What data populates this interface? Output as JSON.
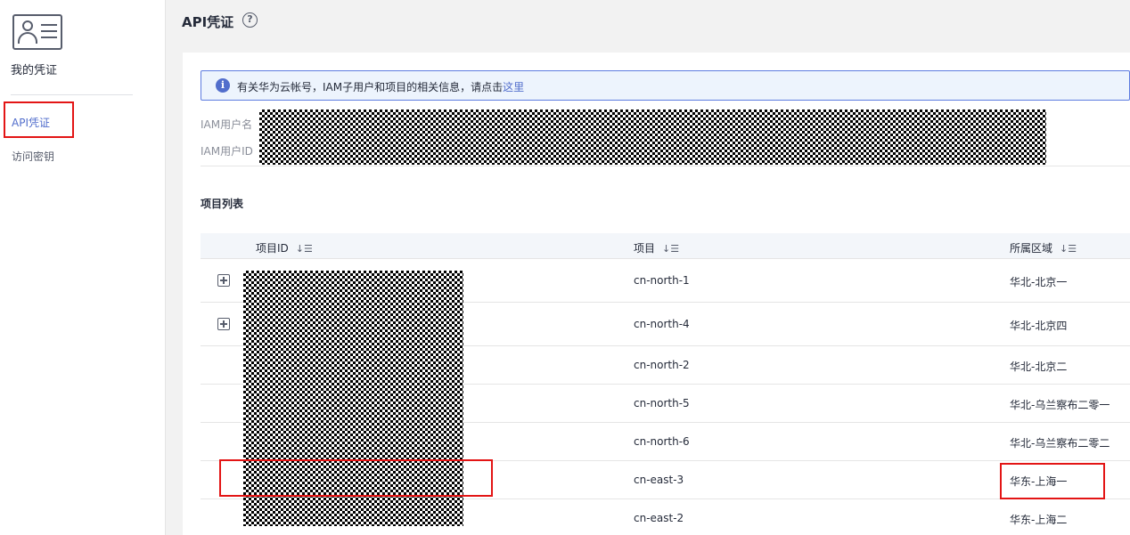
{
  "sidebar": {
    "title": "我的凭证",
    "items": [
      {
        "label": "API凭证",
        "active": true
      },
      {
        "label": "访问密钥",
        "active": false
      }
    ]
  },
  "header": {
    "title": "API凭证",
    "help_icon": "?"
  },
  "info": {
    "text": "有关华为云帐号，IAM子用户和项目的相关信息，请点击",
    "link": "这里",
    "icon": "i"
  },
  "fields": {
    "iam_user_name_label": "IAM用户名",
    "iam_user_id_label": "IAM用户ID"
  },
  "projects": {
    "section_title": "项目列表",
    "columns": [
      "项目ID",
      "项目",
      "所属区域"
    ],
    "sort_icon": "↓☰",
    "rows": [
      {
        "expandable": true,
        "project": "cn-north-1",
        "region": "华北-北京一"
      },
      {
        "expandable": true,
        "project": "cn-north-4",
        "region": "华北-北京四"
      },
      {
        "expandable": false,
        "project": "cn-north-2",
        "region": "华北-北京二"
      },
      {
        "expandable": false,
        "project": "cn-north-5",
        "region": "华北-乌兰察布二零一"
      },
      {
        "expandable": false,
        "project": "cn-north-6",
        "region": "华北-乌兰察布二零二"
      },
      {
        "expandable": false,
        "project": "cn-east-3",
        "region": "华东-上海一"
      },
      {
        "expandable": false,
        "project": "cn-east-2",
        "region": "华东-上海二"
      }
    ]
  },
  "colors": {
    "accent": "#526ecc",
    "highlight": "#e31515"
  }
}
